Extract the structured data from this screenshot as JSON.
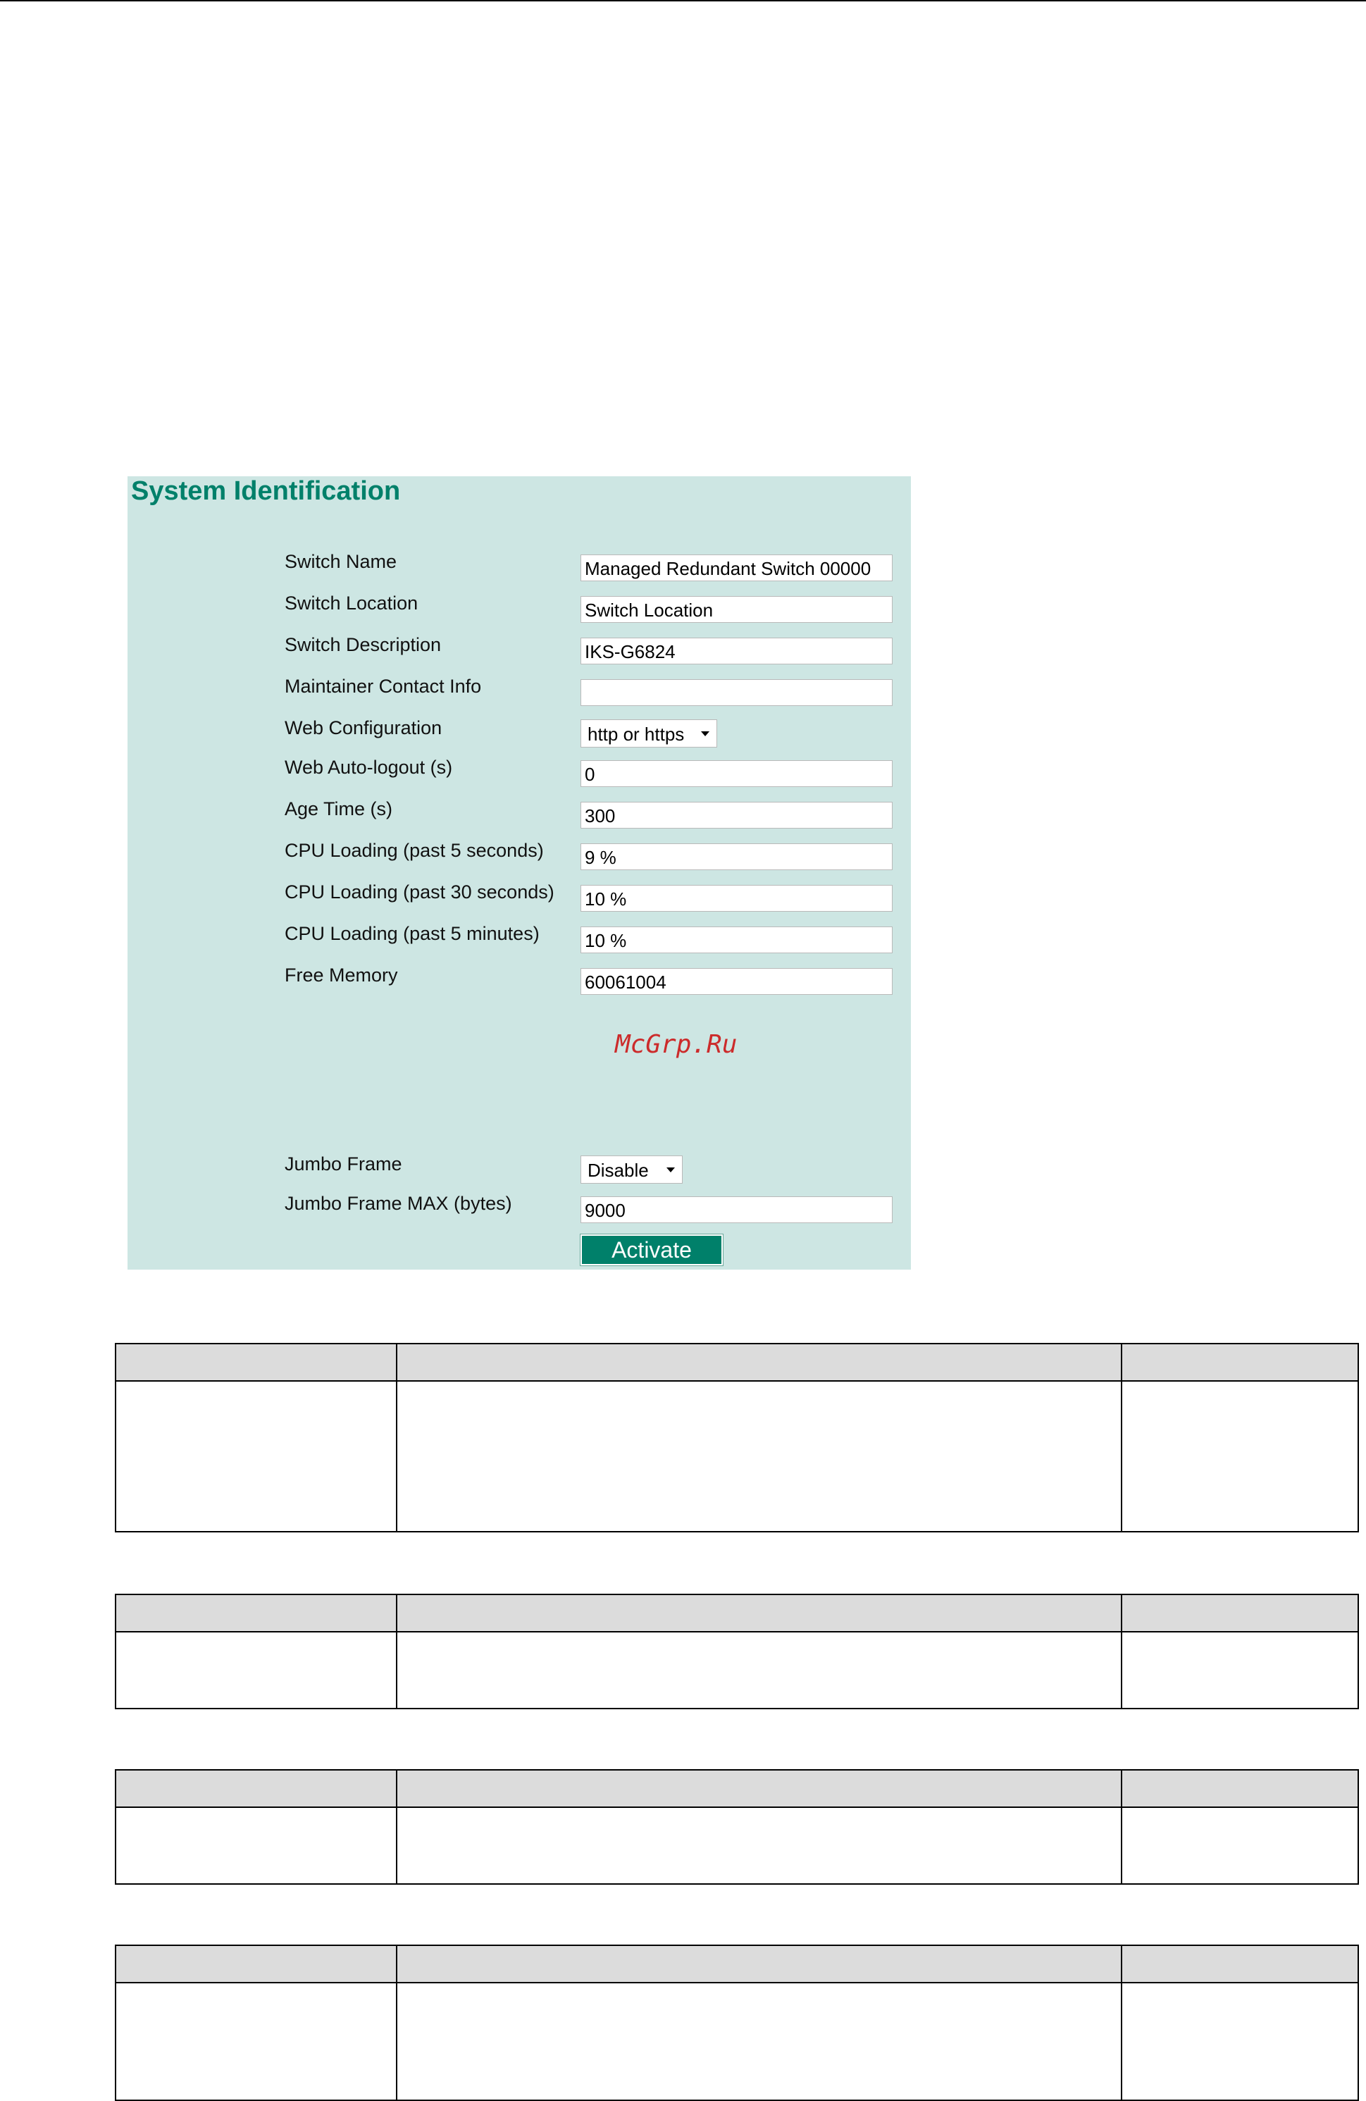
{
  "panel": {
    "title": "System Identification",
    "fields": [
      {
        "label": "Switch Name",
        "type": "text",
        "value": "Managed Redundant Switch 00000"
      },
      {
        "label": "Switch Location",
        "type": "text",
        "value": "Switch Location"
      },
      {
        "label": "Switch Description",
        "type": "text",
        "value": "IKS-G6824"
      },
      {
        "label": "Maintainer Contact Info",
        "type": "text",
        "value": ""
      },
      {
        "label": "Web Configuration",
        "type": "select",
        "value": "http or https"
      },
      {
        "label": "Web Auto-logout (s)",
        "type": "text",
        "value": "0"
      },
      {
        "label": "Age Time (s)",
        "type": "text",
        "value": "300"
      },
      {
        "label": "CPU Loading (past 5 seconds)",
        "type": "text",
        "value": "9 %"
      },
      {
        "label": "CPU Loading (past 30 seconds)",
        "type": "text",
        "value": "10 %"
      },
      {
        "label": "CPU Loading (past 5 minutes)",
        "type": "text",
        "value": "10 %"
      },
      {
        "label": "Free Memory",
        "type": "text",
        "value": "60061004"
      },
      {
        "label": "Jumbo Frame",
        "type": "select",
        "value": "Disable"
      },
      {
        "label": "Jumbo Frame MAX (bytes)",
        "type": "text",
        "value": "9000"
      }
    ],
    "watermark": "McGrp.Ru",
    "activate_label": "Activate"
  },
  "colors": {
    "panel_background": "#cde6e3",
    "title_color": "#00806a",
    "button_color": "#00806a",
    "watermark_color": "#cc2b2b"
  },
  "icons": {
    "dropdown": "chevron-down-icon"
  }
}
